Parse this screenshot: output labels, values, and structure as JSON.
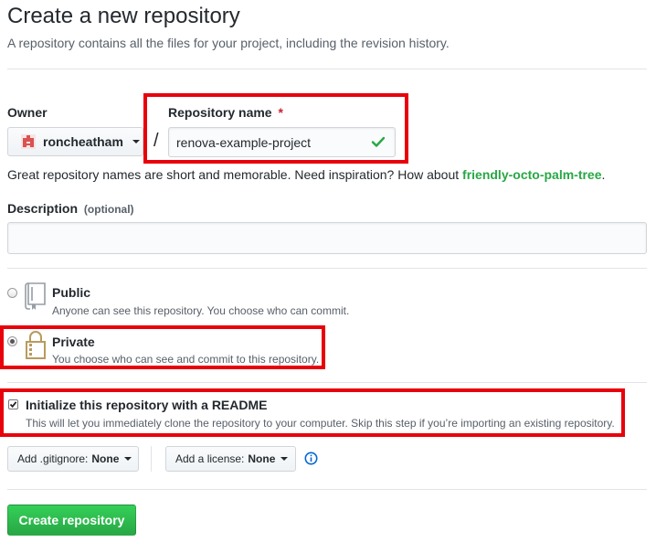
{
  "header": {
    "title": "Create a new repository",
    "subtitle": "A repository contains all the files for your project, including the revision history."
  },
  "owner": {
    "label": "Owner",
    "value": "roncheatham"
  },
  "repo_name": {
    "label": "Repository name",
    "required_mark": "*",
    "value": "renova-example-project",
    "separator": "/"
  },
  "hint": {
    "text": "Great repository names are short and memorable. Need inspiration? How about ",
    "suggestion": "friendly-octo-palm-tree",
    "end": "."
  },
  "description": {
    "label": "Description",
    "optional": "(optional)",
    "value": ""
  },
  "visibility": {
    "selected": "private",
    "public": {
      "title": "Public",
      "note": "Anyone can see this repository. You choose who can commit."
    },
    "private": {
      "title": "Private",
      "note": "You choose who can see and commit to this repository."
    }
  },
  "readme": {
    "checked": true,
    "title": "Initialize this repository with a README",
    "note": "This will let you immediately clone the repository to your computer. Skip this step if you’re importing an existing repository."
  },
  "gitignore": {
    "label": "Add .gitignore:",
    "value": "None"
  },
  "license": {
    "label": "Add a license:",
    "value": "None"
  },
  "submit": {
    "label": "Create repository"
  },
  "colors": {
    "highlight": "#e8000b",
    "primary_button": "#28a745",
    "suggestion": "#28a745",
    "required": "#cb2431",
    "info_icon": "#0366d6"
  }
}
